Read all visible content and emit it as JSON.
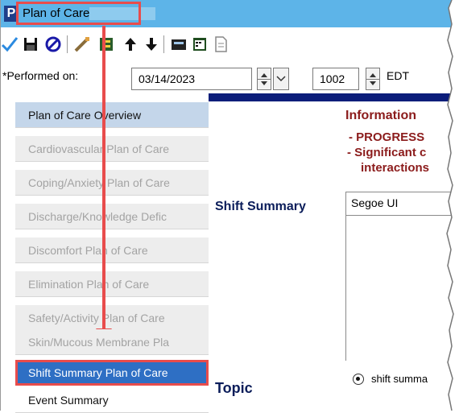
{
  "window": {
    "app_icon_letter": "P",
    "title": "Plan of Care"
  },
  "toolbar": {
    "icons": [
      "checkmark-icon",
      "save-icon",
      "cancel-icon",
      "edit-icon",
      "form-icon",
      "up-arrow-icon",
      "down-arrow-icon",
      "calculator-icon",
      "calendar-icon",
      "document-icon"
    ]
  },
  "performed": {
    "label": "*Performed on:",
    "date": "03/14/2023",
    "time": "1002",
    "timezone": "EDT"
  },
  "sidebar": {
    "items": [
      {
        "label": "Plan of Care Overview",
        "state": "active"
      },
      {
        "label": "Cardiovascular Plan of Care",
        "state": "disabled"
      },
      {
        "label": "Coping/Anxiety Plan of Care",
        "state": "disabled"
      },
      {
        "label": "Discharge/Knowledge Defic",
        "state": "disabled"
      },
      {
        "label": "Discomfort Plan of Care",
        "state": "disabled"
      },
      {
        "label": "Elimination Plan of Care",
        "state": "disabled"
      },
      {
        "label": "Safety/Activity Plan of Care",
        "state": "disabled"
      },
      {
        "label": "Skin/Mucous Membrane Pla",
        "state": "disabled"
      },
      {
        "label": "Shift Summary Plan of Care",
        "state": "selected"
      },
      {
        "label": "Event Summary",
        "state": "normal"
      }
    ]
  },
  "main": {
    "info_title": "Information",
    "info_line1": "- PROGRESS",
    "info_line2": "- Significant c",
    "info_line3": "interactions",
    "shift_summary_label": "Shift Summary",
    "font_value": "Segoe UI",
    "topic_label": "Topic",
    "radio_label": "shift summa"
  },
  "colors": {
    "titlebar": "#5db4e8",
    "highlight": "#e84c4c",
    "selected": "#2e6fc4",
    "header_text": "#8b1b1b",
    "label_text": "#0b1d5a"
  }
}
